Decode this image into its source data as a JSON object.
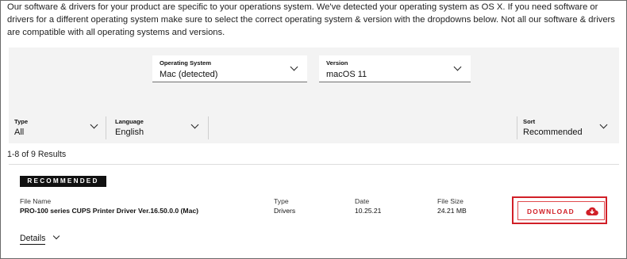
{
  "intro": {
    "text": "Our software & drivers for your product are specific to your operations system. We've detected your operating system as OS X. If you need software or drivers for a different operating system make sure to select the correct operating system & version with the dropdowns below. Not all our software & drivers are compatible with all operating systems and versions."
  },
  "os_selector": {
    "os": {
      "label": "Operating System",
      "value": "Mac (detected)"
    },
    "version": {
      "label": "Version",
      "value": "macOS 11"
    }
  },
  "filters": {
    "type": {
      "label": "Type",
      "value": "All"
    },
    "language": {
      "label": "Language",
      "value": "English"
    },
    "sort": {
      "label": "Sort",
      "value": "Recommended"
    }
  },
  "results": {
    "summary": "1-8 of 9 Results"
  },
  "item": {
    "badge": "RECOMMENDED",
    "headers": {
      "file_name": "File Name",
      "type": "Type",
      "date": "Date",
      "file_size": "File Size"
    },
    "file_name": "PRO-100 series CUPS Printer Driver Ver.16.50.0.0 (Mac)",
    "type": "Drivers",
    "date": "10.25.21",
    "file_size": "24.21 MB",
    "download_label": "DOWNLOAD",
    "details_label": "Details"
  },
  "colors": {
    "accent_red": "#d11f27",
    "panel_bg": "#f3f3f3",
    "badge_bg": "#111111"
  },
  "icons": {
    "dropdown": "chevron-down-icon",
    "download": "cloud-download-icon"
  }
}
